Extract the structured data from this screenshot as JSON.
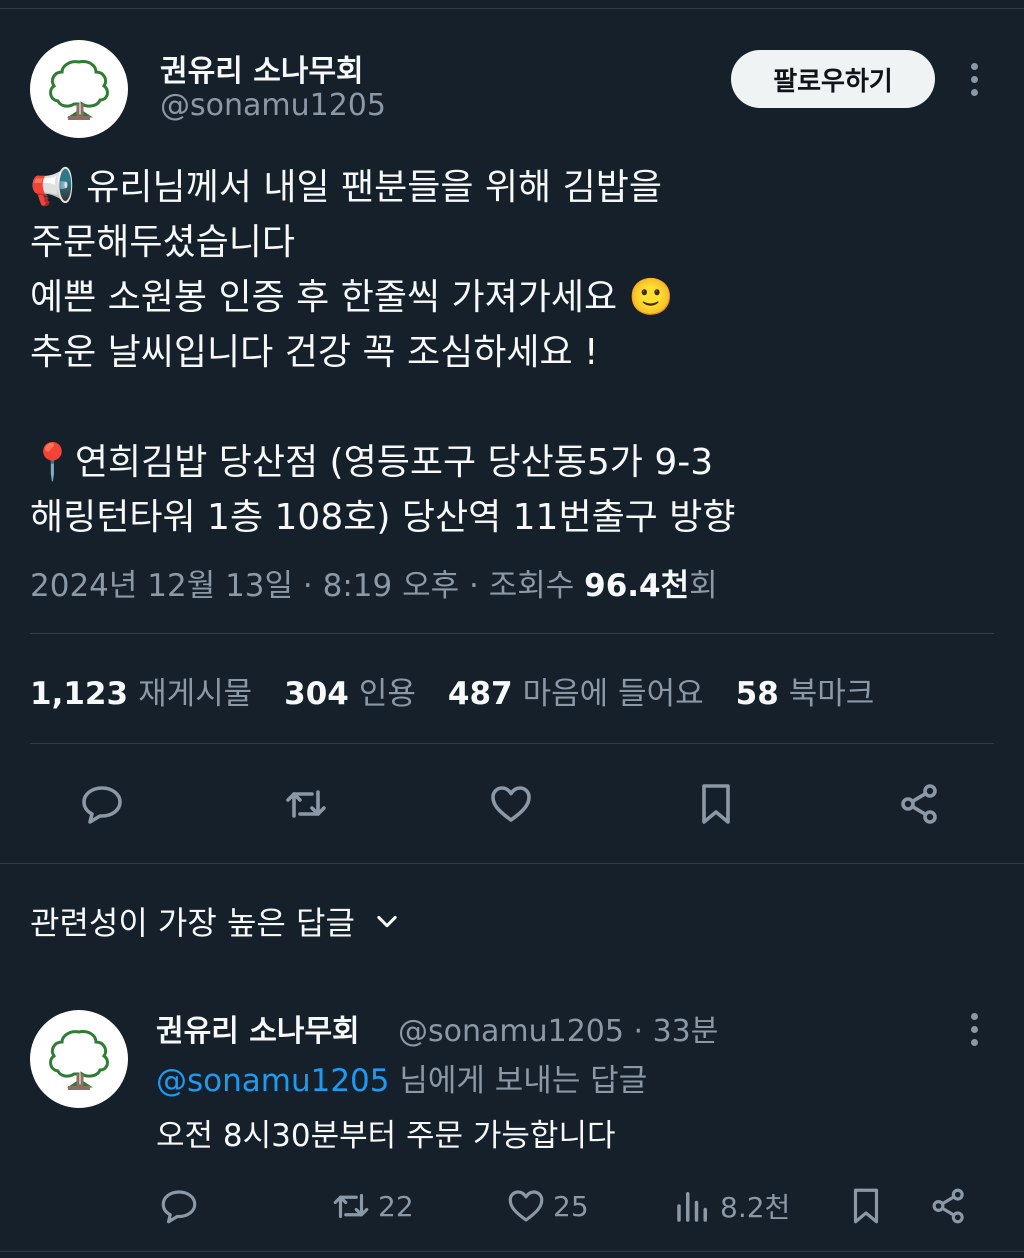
{
  "tweet": {
    "author": {
      "name": "권유리 소나무회",
      "handle": "@sonamu1205",
      "avatar_icon": "tree-icon"
    },
    "follow_label": "팔로우하기",
    "lines": [
      "유리님께서 내일 팬분들을 위해 김밥을",
      "주문해두셨습니다",
      "예쁜 소원봉 인증 후 한줄씩 가져가세요",
      "추운 날씨입니다 건강 꼭 조심하세요 !",
      "",
      "연희김밥 당산점 (영등포구 당산동5가 9-3",
      "해링턴타워 1층 108호) 당산역 11번출구 방향"
    ],
    "emojis": {
      "megaphone": "📢",
      "smile": "🙂",
      "pin": "📍"
    },
    "meta": {
      "date": "2024년 12월 13일",
      "time": "8:19 오후",
      "views_label": "조회수",
      "views_count": "96.4천",
      "views_suffix": "회"
    },
    "stats": {
      "reposts_count": "1,123",
      "reposts_label": "재게시물",
      "quotes_count": "304",
      "quotes_label": "인용",
      "likes_count": "487",
      "likes_label": "마음에 들어요",
      "bookmarks_count": "58",
      "bookmarks_label": "북마크"
    },
    "actions": [
      "reply-icon",
      "retweet-icon",
      "heart-icon",
      "bookmark-icon",
      "share-icon"
    ]
  },
  "replies_sort": {
    "label": "관련성이 가장 높은 답글"
  },
  "reply": {
    "author_name": "권유리 소나무회",
    "handle": "@sonamu1205",
    "time": "33분",
    "reply_to_mention": "@sonamu1205",
    "reply_to_suffix": "님에게 보내는 답글",
    "text": "오전 8시30분부터 주문 가능합니다",
    "retweets": "22",
    "likes": "25",
    "views": "8.2천"
  },
  "colors": {
    "background": "#15202b",
    "text": "#f7f9f9",
    "secondary": "#8b98a5",
    "accent": "#1d9bf0",
    "divider": "#2f3b47"
  }
}
